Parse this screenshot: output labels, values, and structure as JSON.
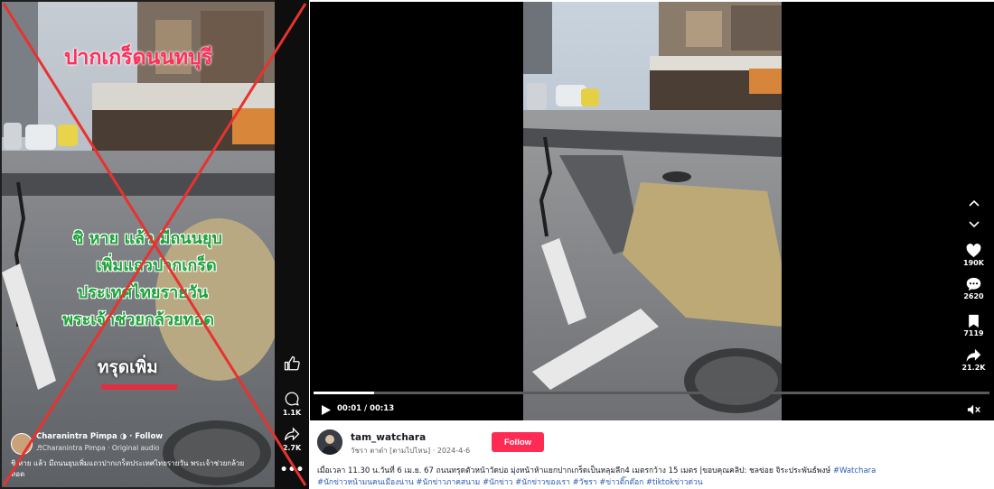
{
  "left": {
    "overlay_title": "ปากเกร็ดนนทบุรี",
    "overlay_lines": [
      "ชิ หาย แล้ว  มีถนนยุบ",
      "เพิ่มแถวปากเกร็ด",
      "ประเทศไทยรายวัน",
      "พระเจ้าช่วยกล้วยทอด"
    ],
    "overlay_sink": "ทรุดเพิ่ม",
    "actions": [
      {
        "icon": "like-icon",
        "count": ""
      },
      {
        "icon": "comment-icon",
        "count": "1.1K"
      },
      {
        "icon": "share-icon",
        "count": "2.7K"
      },
      {
        "icon": "more-icon",
        "count": ""
      }
    ],
    "author": {
      "name": "Charanintra Pimpa",
      "follow_label": "Follow",
      "audio": "Charanintra Pimpa · Original audio"
    },
    "caption_line1": "ชิ หาย แล้ว  มีถนนยุบเพิ่มแถวปากเกร็ดประเทศไทยรายวัน พระเจ้าช่วยกล้วย",
    "caption_line2": "ทอด",
    "colors": {
      "cross": "#e8322f",
      "title": "#ff2e5b",
      "green": "#1ea33a"
    }
  },
  "right": {
    "player": {
      "current_time": "00:01",
      "duration": "00:13",
      "time_display": "00:01 / 00:13",
      "progress_fraction": 0.09
    },
    "side": {
      "likes": "190K",
      "comments": "2620",
      "saves": "7119",
      "shares": "21.2K"
    },
    "author": {
      "handle": "tam_watchara",
      "subtitle": "วัชรา ตาต๋า [ตามไปไหน] · 2024-4-6",
      "follow_label": "Follow"
    },
    "description": {
      "text": "เมื่อเวลา 11.30 น.วันที่ 6 เม.ย. 67 ถนนทรุดตัวหน้าวัดบ่อ มุ่งหน้าห้าแยกปากเกร็ดเป็นหลุมลึก4 เมตรกว้าง 15 เมตร |ขอบคุณคลิป: ชลข่อย จิระประพันธ์พงษ์ ",
      "hashtags_line1": [
        "#Watchara"
      ],
      "hashtags_line2": [
        "#นักข่าวหน้ามนคนเมืองน่าน",
        "#นักข่าวภาคสนาม",
        "#นักข่าว",
        "#นักข่าวของเรา",
        "#วัชรา",
        "#ข่าวติ๊กต๊อก",
        "#tiktokข่าวด่วน"
      ]
    },
    "colors": {
      "follow": "#fe2c55",
      "hashtag": "#2b5db5"
    }
  }
}
